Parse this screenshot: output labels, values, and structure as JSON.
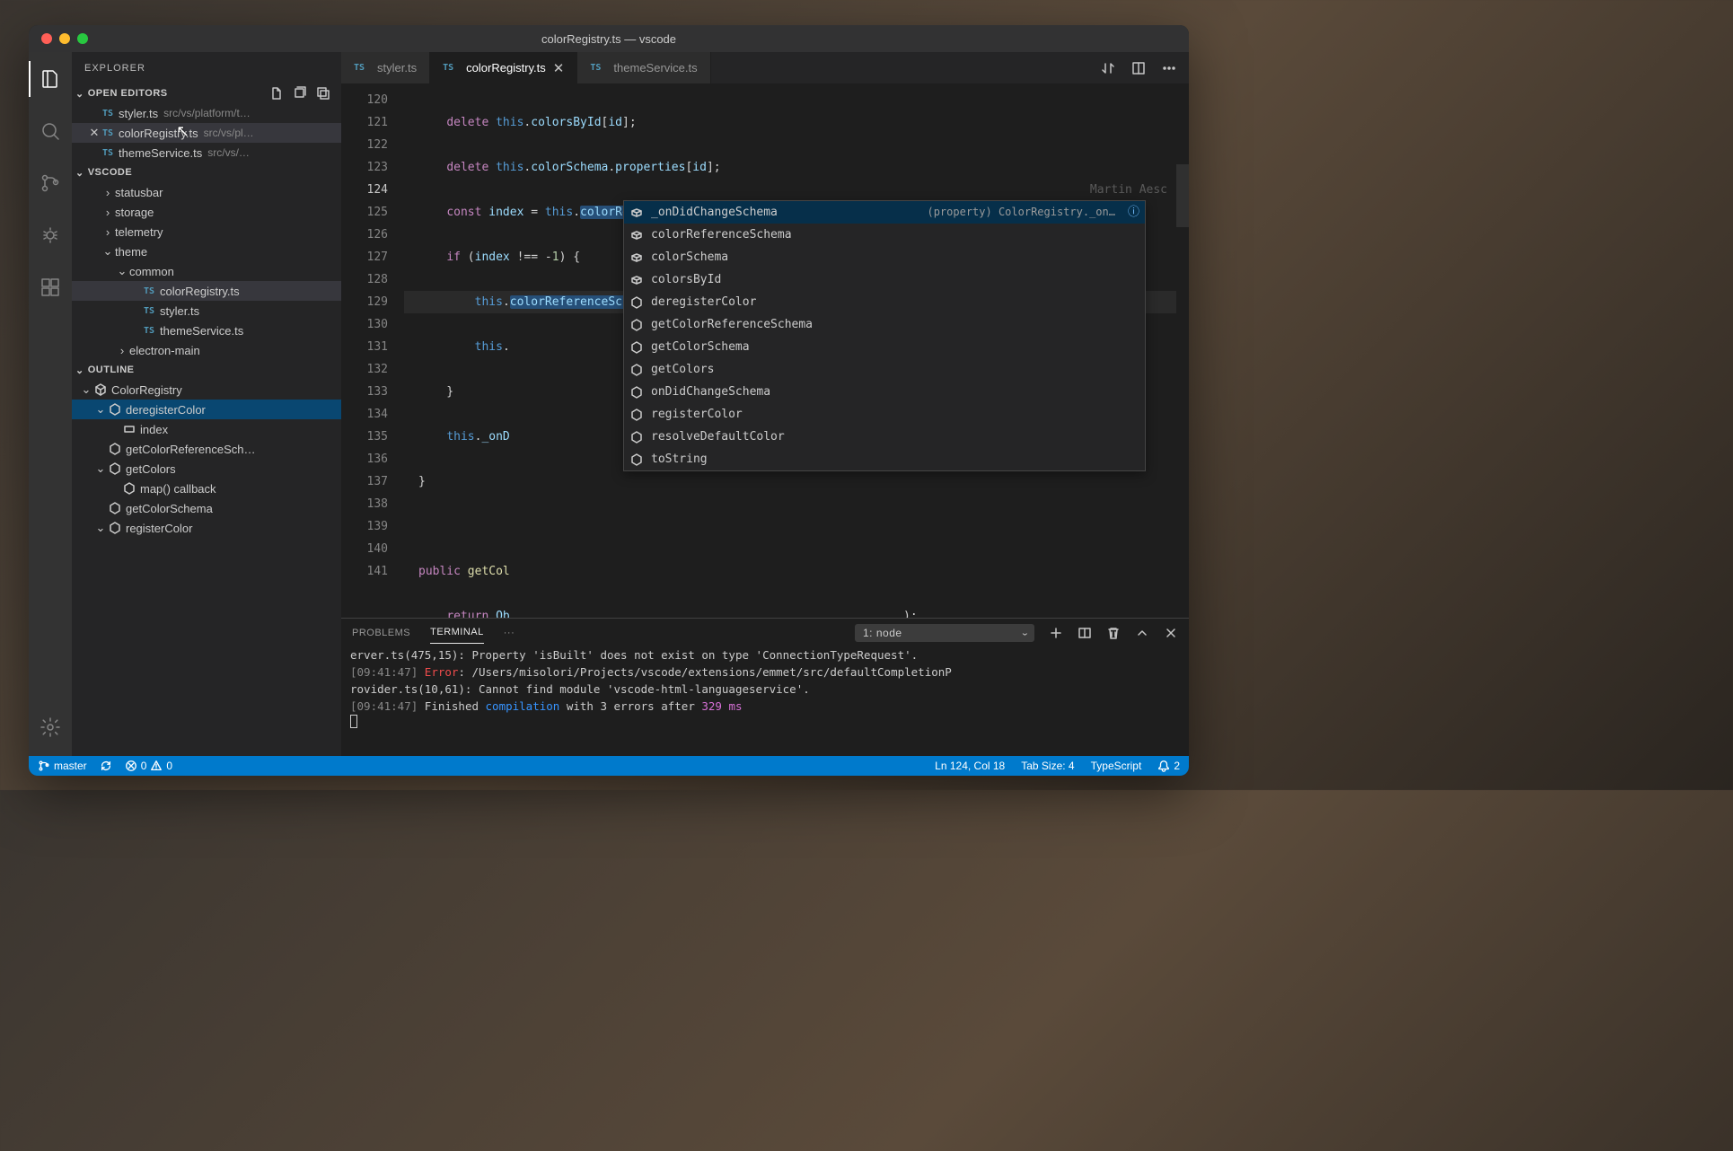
{
  "window": {
    "title": "colorRegistry.ts — vscode"
  },
  "sidebar": {
    "title": "EXPLORER",
    "openEditorsLabel": "OPEN EDITORS",
    "openEditors": [
      {
        "name": "styler.ts",
        "path": "src/vs/platform/t…"
      },
      {
        "name": "colorRegistry.ts",
        "path": "src/vs/pl…"
      },
      {
        "name": "themeService.ts",
        "path": "src/vs/…"
      }
    ],
    "workspaceLabel": "VSCODE",
    "tree": [
      {
        "indent": 2,
        "chev": ">",
        "label": "statusbar"
      },
      {
        "indent": 2,
        "chev": ">",
        "label": "storage"
      },
      {
        "indent": 2,
        "chev": ">",
        "label": "telemetry"
      },
      {
        "indent": 2,
        "chev": "v",
        "label": "theme"
      },
      {
        "indent": 3,
        "chev": "v",
        "label": "common"
      },
      {
        "indent": 4,
        "chev": "",
        "label": "colorRegistry.ts",
        "ts": true,
        "active": true
      },
      {
        "indent": 4,
        "chev": "",
        "label": "styler.ts",
        "ts": true
      },
      {
        "indent": 4,
        "chev": "",
        "label": "themeService.ts",
        "ts": true
      },
      {
        "indent": 3,
        "chev": ">",
        "label": "electron-main"
      }
    ],
    "outlineLabel": "OUTLINE",
    "outline": [
      {
        "indent": 0,
        "chev": "v",
        "icon": "class",
        "label": "ColorRegistry"
      },
      {
        "indent": 1,
        "chev": "v",
        "icon": "method",
        "label": "deregisterColor",
        "selected": true
      },
      {
        "indent": 2,
        "chev": "",
        "icon": "var",
        "label": "index"
      },
      {
        "indent": 1,
        "chev": "",
        "icon": "method",
        "label": "getColorReferenceSch…"
      },
      {
        "indent": 1,
        "chev": "v",
        "icon": "method",
        "label": "getColors"
      },
      {
        "indent": 2,
        "chev": "",
        "icon": "method",
        "label": "map() callback"
      },
      {
        "indent": 1,
        "chev": "",
        "icon": "method",
        "label": "getColorSchema"
      },
      {
        "indent": 1,
        "chev": "v",
        "icon": "method",
        "label": "registerColor"
      }
    ]
  },
  "tabs": [
    {
      "label": "styler.ts"
    },
    {
      "label": "colorRegistry.ts",
      "active": true,
      "close": true
    },
    {
      "label": "themeService.ts"
    }
  ],
  "lineStart": 120,
  "lineEnd": 141,
  "currentLine": 124,
  "blame": "Martin Aesc",
  "suggest": {
    "items": [
      {
        "icon": "field",
        "label": "_onDidChangeSchema",
        "detail": "(property) ColorRegistry._on…",
        "info": true
      },
      {
        "icon": "field",
        "label": "colorReferenceSchema"
      },
      {
        "icon": "field",
        "label": "colorSchema"
      },
      {
        "icon": "field",
        "label": "colorsById"
      },
      {
        "icon": "method",
        "label": "deregisterColor"
      },
      {
        "icon": "method",
        "label": "getColorReferenceSchema"
      },
      {
        "icon": "method",
        "label": "getColorSchema"
      },
      {
        "icon": "method",
        "label": "getColors"
      },
      {
        "icon": "method",
        "label": "onDidChangeSchema"
      },
      {
        "icon": "method",
        "label": "registerColor"
      },
      {
        "icon": "method",
        "label": "resolveDefaultColor"
      },
      {
        "icon": "method",
        "label": "toString"
      }
    ]
  },
  "panel": {
    "tabs": {
      "problems": "PROBLEMS",
      "terminal": "TERMINAL"
    },
    "termSelect": "1: node",
    "out": {
      "l1a": "erver.ts(475,15): Property 'isBuilt' does not exist on type 'ConnectionTypeRequest'.",
      "l2t": "[09:41:47]",
      "l2e": "Error",
      "l2b": ": /Users/misolori/Projects/vscode/extensions/emmet/src/defaultCompletionP",
      "l3": "rovider.ts(10,61): Cannot find module 'vscode-html-languageservice'.",
      "l4t": "[09:41:47]",
      "l4a": " Finished ",
      "l4c": "compilation",
      "l4b": " with 3 errors after ",
      "l4n": "329 ms"
    }
  },
  "status": {
    "branch": "master",
    "errors": "0",
    "warnings": "0",
    "lncol": "Ln 124, Col 18",
    "tabsize": "Tab Size: 4",
    "lang": "TypeScript",
    "bell": "2"
  }
}
